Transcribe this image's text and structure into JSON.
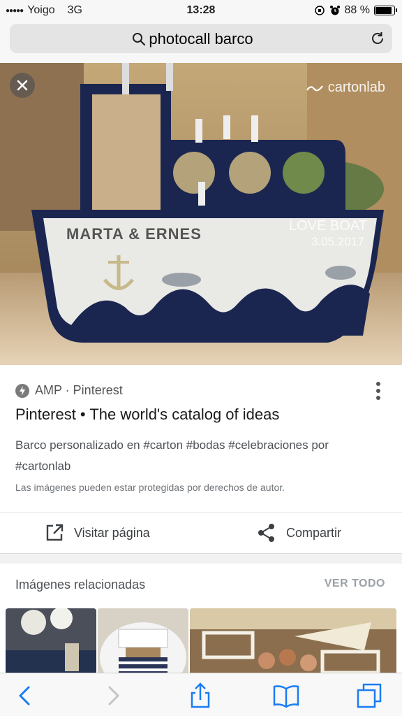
{
  "status": {
    "carrier": "Yoigo",
    "network": "3G",
    "time": "13:28",
    "battery": "88 %",
    "battery_level": 0.88
  },
  "search": {
    "query": "photocall barco"
  },
  "hero": {
    "brand": "cartonlab",
    "boat_name": "MARTA & ERNES",
    "boat_slogan": "LOVE BOAT",
    "boat_date": "3.05.2017"
  },
  "result": {
    "source": "AMP · Pinterest",
    "title": "Pinterest • The world's catalog of ideas",
    "description": "Barco personalizado en #carton #bodas #celebraciones por #cartonlab",
    "copyright_note": "Las imágenes pueden estar protegidas por derechos de autor.",
    "visit_label": "Visitar página",
    "share_label": "Compartir"
  },
  "related": {
    "title": "Imágenes relacionadas",
    "see_all": "VER TODO"
  },
  "colors": {
    "ios_blue": "#1a7cf5",
    "boat_navy": "#1b2650"
  }
}
